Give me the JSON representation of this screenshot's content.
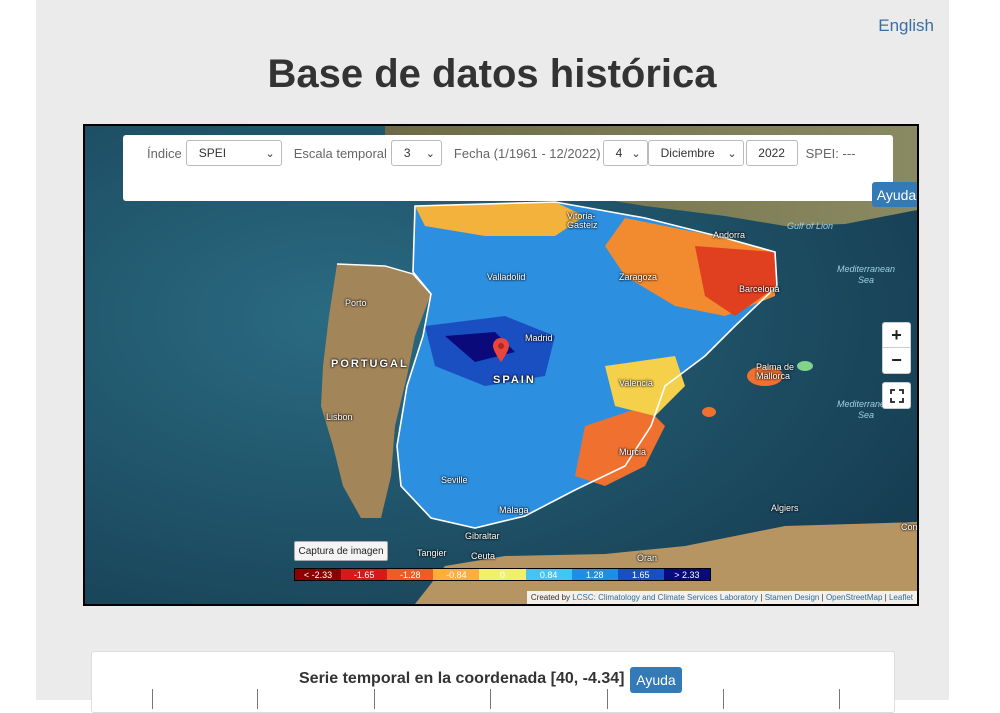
{
  "header": {
    "language_link": "English",
    "title": "Base de datos histórica"
  },
  "controls": {
    "indice_label": "Índice",
    "indice_value": "SPEI",
    "escala_label": "Escala temporal",
    "escala_value": "3",
    "fecha_label": "Fecha (1/1961 - 12/2022)",
    "day_value": "4",
    "month_value": "Diciembre",
    "year_value": "2022",
    "spei_readout": "SPEI: ---",
    "help_label": "Ayuda"
  },
  "map": {
    "zoom_in": "+",
    "zoom_out": "−",
    "fullscreen_icon": "fullscreen-icon",
    "cities": [
      {
        "name": "Vitoria-\nGasteiz"
      },
      {
        "name": "Andorra"
      },
      {
        "name": "Valladolid"
      },
      {
        "name": "Zaragoza"
      },
      {
        "name": "Barcelona"
      },
      {
        "name": "Porto"
      },
      {
        "name": "Madrid"
      },
      {
        "name": "Palma de\nMallorca"
      },
      {
        "name": "Valencia"
      },
      {
        "name": "Lisbon"
      },
      {
        "name": "Murcia"
      },
      {
        "name": "Seville"
      },
      {
        "name": "Málaga"
      },
      {
        "name": "Gibraltar"
      },
      {
        "name": "Tangier"
      },
      {
        "name": "Ceuta"
      },
      {
        "name": "Oran"
      },
      {
        "name": "Algiers"
      },
      {
        "name": "Con"
      }
    ],
    "countries": [
      "PORTUGAL",
      "SPAIN"
    ],
    "seas": [
      "Gulf of Lion",
      "Mediterranean\nSea",
      "Mediterranean\nSea"
    ],
    "screenshot_button": "Captura de imagen",
    "legend": [
      {
        "label": "< -2.33",
        "color": "#8b0000"
      },
      {
        "label": "-1.65",
        "color": "#d7191c"
      },
      {
        "label": "-1.28",
        "color": "#f05a28"
      },
      {
        "label": "-0.84",
        "color": "#fdae3b"
      },
      {
        "label": "0",
        "color": "#f2f06a"
      },
      {
        "label": "0.84",
        "color": "#42c6f0"
      },
      {
        "label": "1.28",
        "color": "#1f8fe0"
      },
      {
        "label": "1.65",
        "color": "#1a4fc2"
      },
      {
        "label": "> 2.33",
        "color": "#0a0a7a"
      }
    ],
    "attribution": {
      "prefix": "Created by",
      "lcsc": "LCSC: Climatology and Climate Services Laboratory",
      "stamen": "Stamen Design",
      "osm": "OpenStreetMap",
      "leaflet": "Leaflet",
      "sep": "|"
    }
  },
  "series": {
    "title": "Serie temporal en la coordenada [40, -4.34]",
    "help_label": "Ayuda"
  }
}
